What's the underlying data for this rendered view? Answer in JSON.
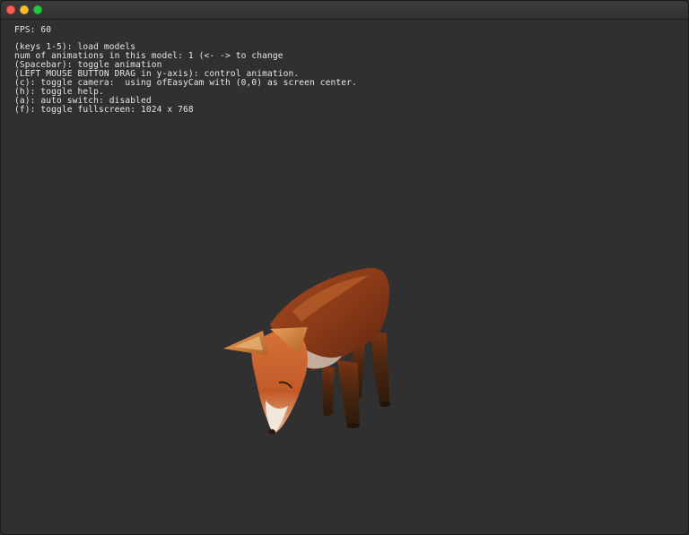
{
  "window": {
    "controls": [
      "close",
      "minimize",
      "maximize"
    ]
  },
  "overlay": {
    "fps_line": "FPS: 60",
    "help_lines": [
      "(keys 1-5): load models",
      "num of animations in this model: 1 (<- -> to change",
      "(Spacebar): toggle animation",
      "(LEFT MOUSE BUTTON DRAG in y-axis): control animation.",
      "(c): toggle camera:  using ofEasyCam with (0,0) as screen center.",
      "(h): toggle help.",
      "(a): auto switch: disabled",
      "(f): toggle fullscreen: 1024 x 768"
    ]
  },
  "scene": {
    "model": "fox",
    "background_color": "#303030"
  }
}
